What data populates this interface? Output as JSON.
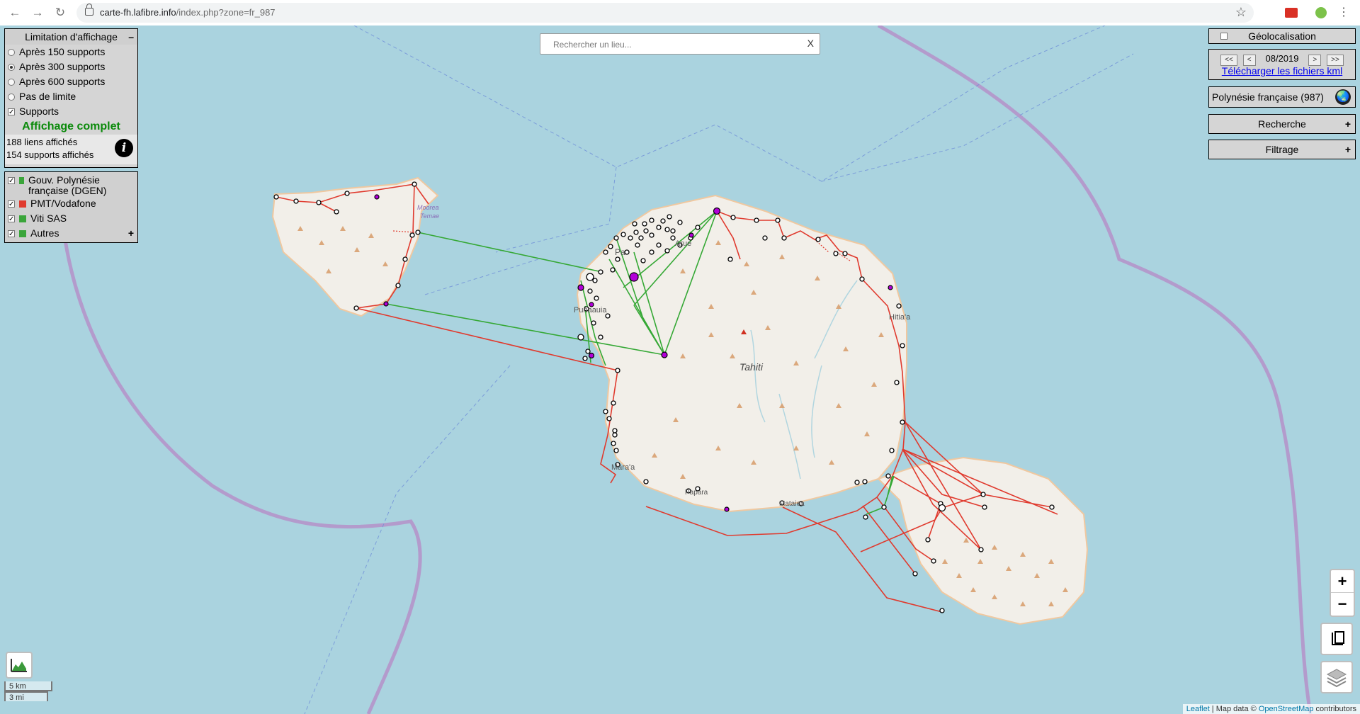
{
  "browser": {
    "url_host": "carte-fh.lafibre.info",
    "url_path": "/index.php?zone=fr_987"
  },
  "limitation": {
    "title": "Limitation d'affichage",
    "toggle": "–",
    "options": [
      {
        "label": "Après 150 supports",
        "selected": false
      },
      {
        "label": "Après 300 supports",
        "selected": true
      },
      {
        "label": "Après 600 supports",
        "selected": false
      },
      {
        "label": "Pas de limite",
        "selected": false
      }
    ],
    "supports_label": "Supports",
    "status": "Affichage complet",
    "links_count": "188 liens affichés",
    "supports_count": "154 supports affichés"
  },
  "operators": [
    {
      "label": "Gouv. Polynésie française (DGEN)",
      "color": "#3aa53a"
    },
    {
      "label": "PMT/Vodafone",
      "color": "#e03a2e"
    },
    {
      "label": "Viti SAS",
      "color": "#3aa53a"
    },
    {
      "label": "Autres",
      "color": "#3aa53a"
    }
  ],
  "operators_more": "+",
  "search": {
    "placeholder": "Rechercher un lieu...",
    "clear": "X"
  },
  "right": {
    "geoloc": "Géolocalisation",
    "date_first": "<<",
    "date_prev": "<",
    "date": "08/2019",
    "date_next": ">",
    "date_last": ">>",
    "kml_link": "Télécharger les fichiers kml",
    "zone": "Polynésie française (987)",
    "recherche": "Recherche",
    "filtrage": "Filtrage",
    "plus": "+"
  },
  "map_labels": {
    "tahiti": "Tahiti",
    "moorea1": "Moorea",
    "moorea2": "Temae",
    "papeete": "Pa",
    "arue": "Arue",
    "punaauia": "Punaauia",
    "hitiaa": "Hitia'a",
    "maraa": "Māra'a",
    "papara": "Papara",
    "mataiea": "Mataiea"
  },
  "zoom": {
    "in": "+",
    "out": "−"
  },
  "scale": {
    "km": "5 km",
    "mi": "3 mi"
  },
  "attribution": {
    "leaflet": "Leaflet",
    "sep": " | Map data © ",
    "osm": "OpenStreetMap",
    "suffix": " contributors"
  },
  "colors": {
    "red_link": "#e03a2e",
    "green_link": "#35a835",
    "water": "#aad3df",
    "land": "#f2efe9",
    "border": "#b591c9",
    "marker_purple": "#b200d8"
  }
}
